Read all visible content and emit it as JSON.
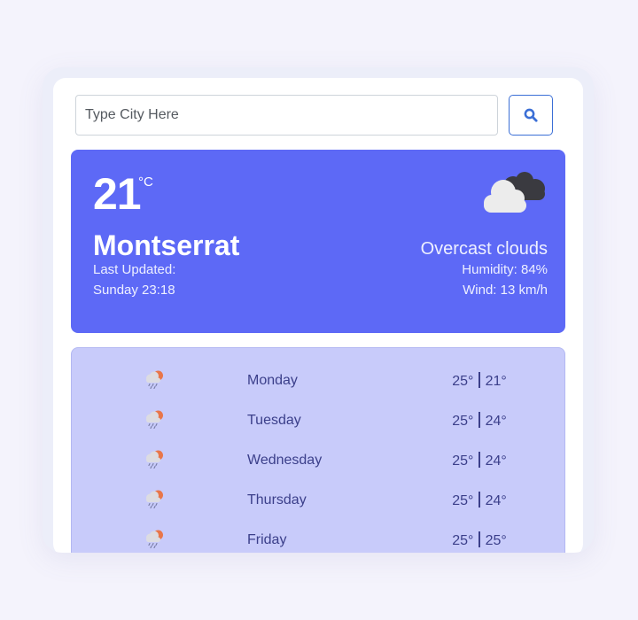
{
  "search": {
    "placeholder": "Type City Here",
    "button_icon": "search-icon"
  },
  "current": {
    "temperature": "21",
    "unit": "°C",
    "city": "Montserrat",
    "last_updated_label": "Last Updated:",
    "last_updated_time": "Sunday 23:18",
    "condition_icon": "overcast-cloud-icon",
    "description": "Overcast clouds",
    "humidity": "Humidity: 84%",
    "wind": "Wind: 13 km/h"
  },
  "forecast": [
    {
      "day": "Monday",
      "high": "25°",
      "low": "21°",
      "icon": "rain-sun-icon"
    },
    {
      "day": "Tuesday",
      "high": "25°",
      "low": "24°",
      "icon": "rain-sun-icon"
    },
    {
      "day": "Wednesday",
      "high": "25°",
      "low": "24°",
      "icon": "rain-sun-icon"
    },
    {
      "day": "Thursday",
      "high": "25°",
      "low": "24°",
      "icon": "rain-sun-icon"
    },
    {
      "day": "Friday",
      "high": "25°",
      "low": "25°",
      "icon": "rain-sun-icon"
    }
  ],
  "colors": {
    "page_bg": "#f4f3fc",
    "card_accent": "#5d69f6",
    "forecast_bg": "#c8cbfa",
    "forecast_text": "#3b3f8a",
    "search_border": "#3b6fd6"
  }
}
